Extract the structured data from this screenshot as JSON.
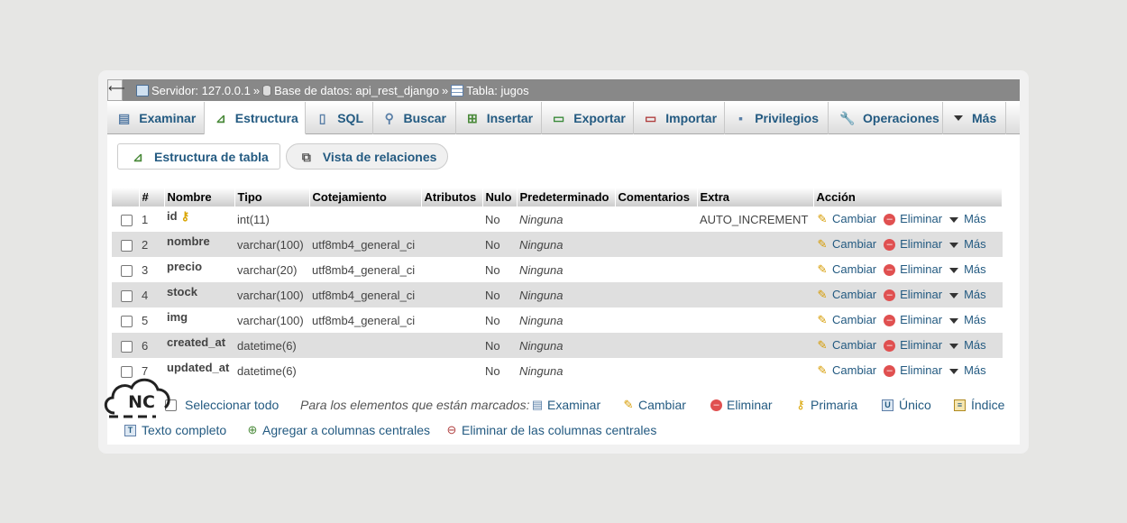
{
  "breadcrumb": {
    "back_glyph": "⟵",
    "server": "Servidor: 127.0.0.1",
    "database": "Base de datos: api_rest_django",
    "table": "Tabla: jugos",
    "separator": "»"
  },
  "tabs": [
    {
      "label": "Examinar",
      "icon": "browse-icon"
    },
    {
      "label": "Estructura",
      "icon": "structure-icon"
    },
    {
      "label": "SQL",
      "icon": "sql-icon"
    },
    {
      "label": "Buscar",
      "icon": "search-icon"
    },
    {
      "label": "Insertar",
      "icon": "insert-icon"
    },
    {
      "label": "Exportar",
      "icon": "export-icon"
    },
    {
      "label": "Importar",
      "icon": "import-icon"
    },
    {
      "label": "Privilegios",
      "icon": "privileges-icon"
    },
    {
      "label": "Operaciones",
      "icon": "wrench-icon"
    },
    {
      "label": "Más",
      "icon": "chevron-down-icon"
    }
  ],
  "active_tab": "Estructura",
  "subtabs": {
    "structure": "Estructura de tabla",
    "relations": "Vista de relaciones"
  },
  "table": {
    "headers": [
      "#",
      "Nombre",
      "Tipo",
      "Cotejamiento",
      "Atributos",
      "Nulo",
      "Predeterminado",
      "Comentarios",
      "Extra",
      "Acción"
    ],
    "rows": [
      {
        "n": "1",
        "name": "id",
        "type": "int(11)",
        "collation": "",
        "null": "No",
        "default": "Ninguna",
        "extra": "AUTO_INCREMENT",
        "primary": true
      },
      {
        "n": "2",
        "name": "nombre",
        "type": "varchar(100)",
        "collation": "utf8mb4_general_ci",
        "null": "No",
        "default": "Ninguna",
        "extra": ""
      },
      {
        "n": "3",
        "name": "precio",
        "type": "varchar(20)",
        "collation": "utf8mb4_general_ci",
        "null": "No",
        "default": "Ninguna",
        "extra": ""
      },
      {
        "n": "4",
        "name": "stock",
        "type": "varchar(100)",
        "collation": "utf8mb4_general_ci",
        "null": "No",
        "default": "Ninguna",
        "extra": ""
      },
      {
        "n": "5",
        "name": "img",
        "type": "varchar(100)",
        "collation": "utf8mb4_general_ci",
        "null": "No",
        "default": "Ninguna",
        "extra": ""
      },
      {
        "n": "6",
        "name": "created_at",
        "type": "datetime(6)",
        "collation": "",
        "null": "No",
        "default": "Ninguna",
        "extra": ""
      },
      {
        "n": "7",
        "name": "updated_at",
        "type": "datetime(6)",
        "collation": "",
        "null": "No",
        "default": "Ninguna",
        "extra": ""
      }
    ],
    "actions": {
      "change": "Cambiar",
      "delete": "Eliminar",
      "more": "Más"
    }
  },
  "bulk": {
    "select_all": "Seleccionar todo",
    "with_selected": "Para los elementos que están marcados:",
    "browse": "Examinar",
    "change": "Cambiar",
    "delete": "Eliminar",
    "primary": "Primaria",
    "unique": "Único",
    "index": "Índice",
    "fulltext": "Texto completo",
    "add_central": "Agregar a columnas centrales",
    "remove_central": "Eliminar de las columnas centrales"
  },
  "watermark": {
    "text": "NC"
  },
  "colors": {
    "link": "#235a81",
    "header_bar": "#888888",
    "delete": "#e05050"
  }
}
